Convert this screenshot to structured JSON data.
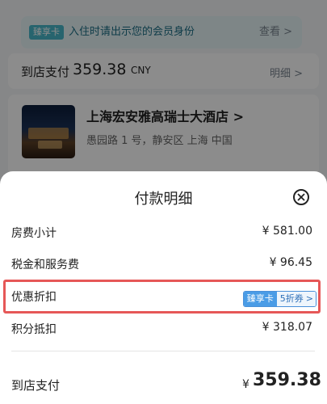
{
  "background": {
    "member_tag": "臻享卡",
    "member_text": "入住时请出示您的会员身份",
    "member_view": "查看 >",
    "pay_label": "到店支付",
    "pay_amount": "359.38",
    "pay_unit": "CNY",
    "pay_detail": "明细 >",
    "hotel_name": "上海宏安雅高瑞士大酒店 >",
    "hotel_address": "愚园路 1 号，静安区 上海 中国"
  },
  "sheet": {
    "title": "付款明细",
    "rows": [
      {
        "label": "房费小计",
        "value": "¥ 581.00"
      },
      {
        "label": "税金和服务费",
        "value": "¥ 96.45"
      },
      {
        "label": "优惠折扣",
        "tag_left": "臻享卡",
        "tag_right": "5折券",
        "tag_chevron": ">"
      },
      {
        "label": "积分抵扣",
        "value": "¥ 318.07"
      }
    ],
    "total_label": "到店支付",
    "total_currency": "¥",
    "total_amount": "359.38"
  },
  "icons": {
    "close": "close-circle-icon",
    "chevron": "chevron-right-icon"
  },
  "colors": {
    "highlight_border": "#e65757",
    "member_tag_bg": "#47b7c8",
    "discount_tag_bg": "#4a9ce6"
  }
}
